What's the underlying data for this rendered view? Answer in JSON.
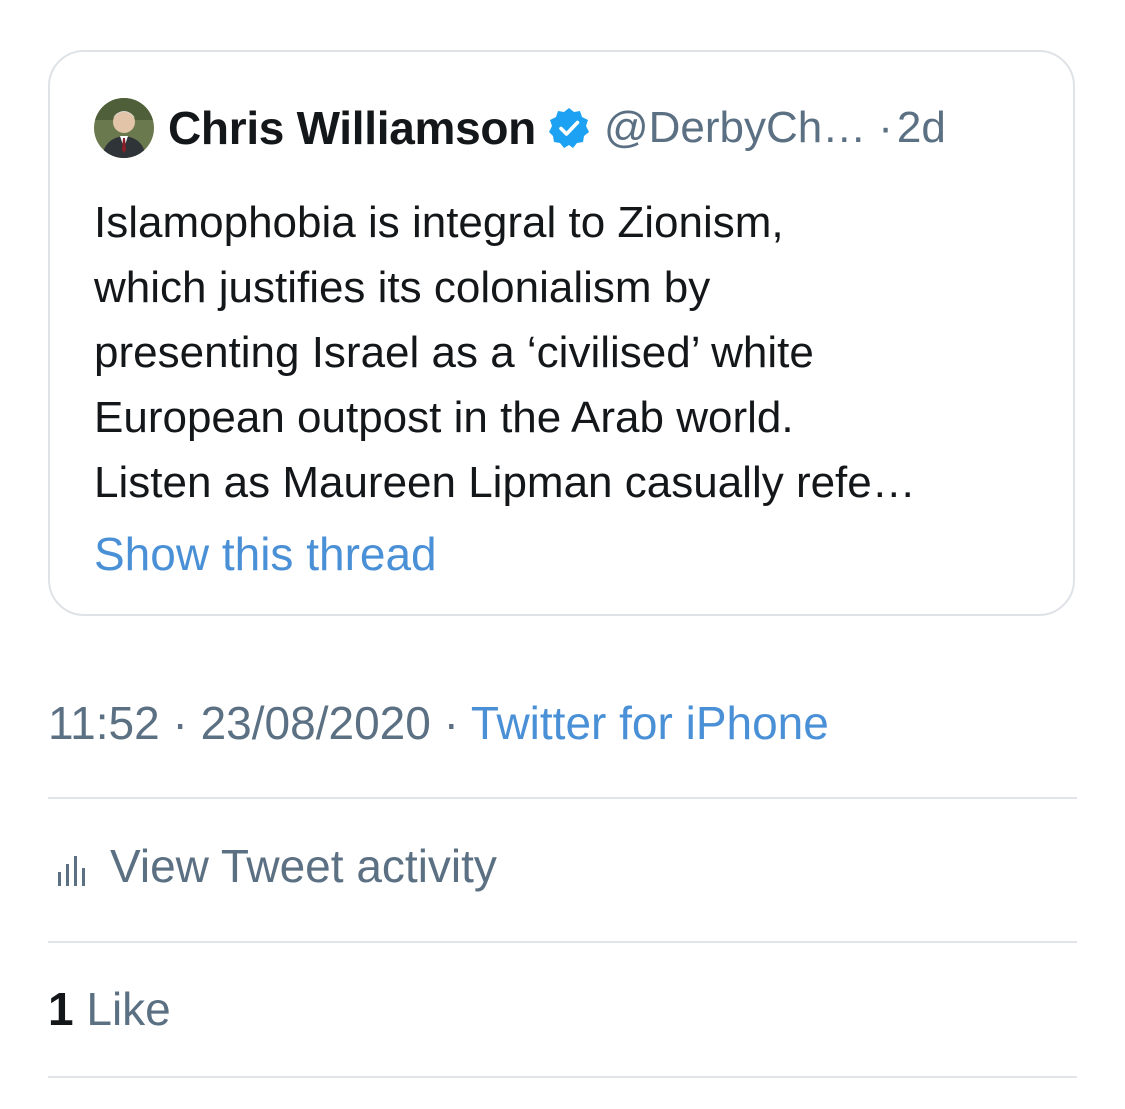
{
  "quoted_tweet": {
    "author_name": "Chris Williamson",
    "verified_icon": "verified-badge-icon",
    "handle": "@DerbyCh…",
    "separator": "·",
    "age": "2d",
    "text_lines": [
      "Islamophobia is integral to Zionism,",
      "which justifies its colonialism by",
      "presenting Israel as a ‘civilised’ white",
      "European outpost in the Arab world.",
      "Listen as Maureen Lipman casually refe…"
    ],
    "show_thread_label": "Show this thread"
  },
  "tweet_meta": {
    "time": "11:52",
    "separator": "·",
    "date": "23/08/2020",
    "source": "Twitter for iPhone"
  },
  "activity": {
    "icon": "bar-chart-icon",
    "label": "View Tweet activity"
  },
  "likes": {
    "count": "1",
    "label": "Like"
  },
  "colors": {
    "text_primary": "#14171a",
    "text_secondary": "#5b7083",
    "link": "#4a90d6",
    "verified": "#1da1f2",
    "divider": "#e1e5e9"
  }
}
